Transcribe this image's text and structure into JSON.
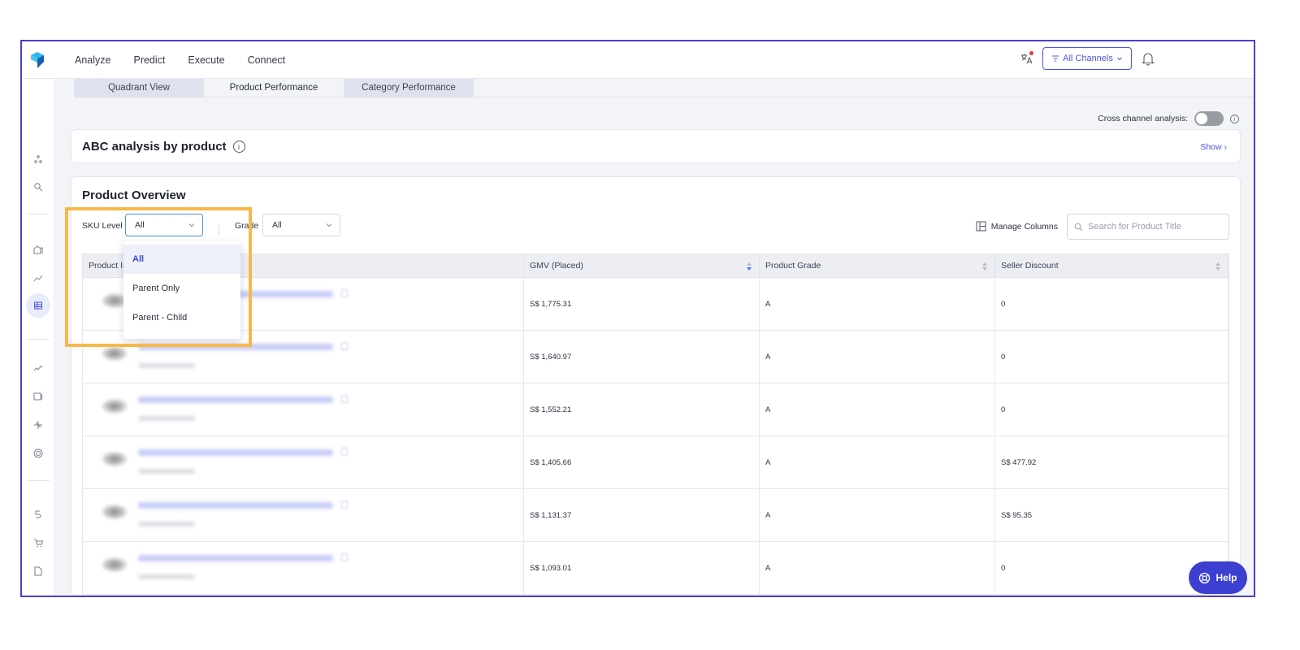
{
  "nav": {
    "items": [
      "Analyze",
      "Predict",
      "Execute",
      "Connect"
    ],
    "channels_label": "All Channels"
  },
  "tabs": [
    "Quadrant View",
    "Product Performance",
    "Category Performance"
  ],
  "cross_channel_label": "Cross channel analysis:",
  "abc": {
    "title": "ABC analysis by product",
    "show_label": "Show"
  },
  "overview": {
    "title": "Product Overview",
    "sku_label": "SKU Level",
    "sku_value": "All",
    "grade_label": "Grade",
    "grade_value": "All",
    "manage_columns": "Manage Columns",
    "search_placeholder": "Search for Product Title"
  },
  "table": {
    "headers": [
      "Product ID",
      "GMV (Placed)",
      "Product Grade",
      "Seller Discount"
    ],
    "rows": [
      {
        "gmv": "S$ 1,775.31",
        "grade": "A",
        "discount": "0"
      },
      {
        "gmv": "S$ 1,640.97",
        "grade": "A",
        "discount": "0"
      },
      {
        "gmv": "S$ 1,552.21",
        "grade": "A",
        "discount": "0"
      },
      {
        "gmv": "S$ 1,405.66",
        "grade": "A",
        "discount": "S$ 477.92"
      },
      {
        "gmv": "S$ 1,131.37",
        "grade": "A",
        "discount": "S$ 95.35"
      },
      {
        "gmv": "S$ 1,093.01",
        "grade": "A",
        "discount": "0"
      }
    ]
  },
  "sku_dropdown": {
    "options": [
      "All",
      "Parent Only",
      "Parent - Child"
    ],
    "selected": "All"
  },
  "help_label": "Help",
  "colors": {
    "accent": "#4a56e2",
    "frame": "#4b3fc7",
    "highlight": "#f7b84a",
    "help": "#3c3fd0"
  }
}
